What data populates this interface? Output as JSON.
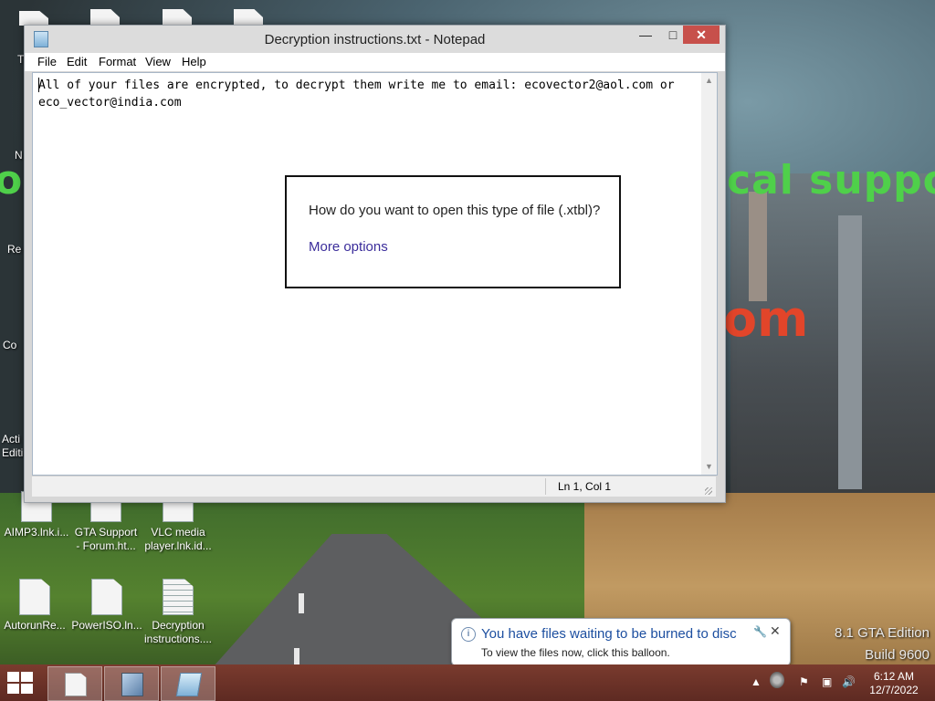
{
  "wallpaper": {
    "banner_left": "o",
    "banner_right": "cal suppo",
    "banner_red": "om"
  },
  "desktop": {
    "partial_labels": [
      "T",
      "N",
      "Re",
      "Co",
      "Acti",
      "Editi"
    ],
    "icons": [
      {
        "label": "AIMP3.lnk.i...",
        "icon": "file-icon"
      },
      {
        "label": "GTA Support\n- Forum.ht...",
        "icon": "file-icon"
      },
      {
        "label": "VLC media\nplayer.lnk.id...",
        "icon": "file-icon"
      },
      {
        "label": "AutorunRe...",
        "icon": "file-icon"
      },
      {
        "label": "PowerISO.ln...",
        "icon": "file-icon"
      },
      {
        "label": "Decryption\ninstructions....",
        "icon": "text-file-icon"
      }
    ]
  },
  "notepad": {
    "title": "Decryption instructions.txt - Notepad",
    "controls": {
      "minimize": "—",
      "maximize": "□",
      "close": "✕"
    },
    "menu": [
      "File",
      "Edit",
      "Format",
      "View",
      "Help"
    ],
    "content": "All of your files are encrypted, to decrypt them write me to email: ecovector2@aol.com or\neco_vector@india.com",
    "status": "Ln 1, Col 1"
  },
  "open_with": {
    "question": "How do you want to open this type of file (.xtbl)?",
    "more": "More options"
  },
  "balloon": {
    "title": "You have files waiting to be burned to disc",
    "subtitle": "To view the files now, click this balloon.",
    "close": "✕"
  },
  "watermark": {
    "line1": "8.1 GTA Edition",
    "line2": "Build 9600"
  },
  "taskbar": {
    "pinned": [
      "file-explorer-icon",
      "control-panel-icon",
      "notepad-icon"
    ],
    "tray_arrow": "▲",
    "time": "6:12 AM",
    "date": "12/7/2022"
  },
  "colors": {
    "taskbar": "#6a3228",
    "link": "#3b2d9b",
    "balloon_title": "#1d4fa0",
    "close_button": "#c7504b"
  }
}
